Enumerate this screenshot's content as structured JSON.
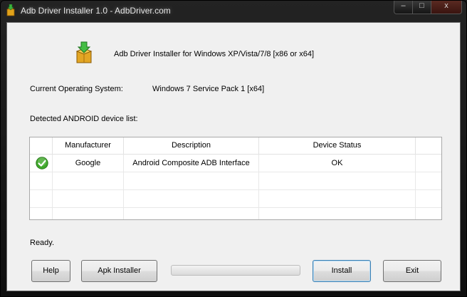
{
  "window": {
    "title": "Adb Driver Installer 1.0  -  AdbDriver.com",
    "min_glyph": "‒",
    "max_glyph": "□",
    "close_glyph": "x"
  },
  "header": {
    "text": "Adb Driver Installer for Windows XP/Vista/7/8 [x86 or x64]"
  },
  "os": {
    "label": "Current Operating System:",
    "value": "Windows 7 Service Pack 1 [x64]"
  },
  "devices": {
    "label": "Detected ANDROID device list:",
    "columns": [
      "",
      "Manufacturer",
      "Description",
      "Device Status",
      ""
    ],
    "rows": [
      {
        "icon": "check-circle-icon",
        "manufacturer": "Google",
        "description": "Android Composite ADB Interface",
        "status": "OK"
      }
    ]
  },
  "status": {
    "text": "Ready."
  },
  "progress": {
    "value": 0
  },
  "buttons": {
    "help": "Help",
    "apk_installer": "Apk Installer",
    "install": "Install",
    "exit": "Exit"
  },
  "colors": {
    "ok_green": "#3fa82a",
    "accent": "#3c7fb1"
  }
}
